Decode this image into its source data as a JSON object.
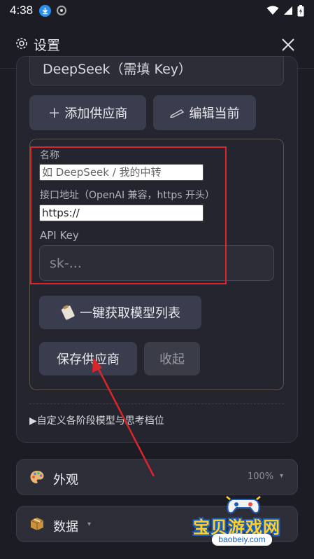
{
  "status_bar": {
    "time": "4:38",
    "icons": [
      "download-icon",
      "record-icon",
      "wifi-icon",
      "signal-icon",
      "battery-icon"
    ]
  },
  "header": {
    "title": "设置",
    "icon": "gear-icon",
    "close_icon": "close-icon"
  },
  "provider_select": {
    "value": "DeepSeek（需填 Key）"
  },
  "buttons": {
    "add_provider": "＋ 添加供应商",
    "edit_current": "编辑当前"
  },
  "form": {
    "name_label": "名称",
    "name_placeholder": "如 DeepSeek / 我的中转",
    "endpoint_label": "接口地址（OpenAI 兼容，https 开头）",
    "endpoint_value": "https://",
    "apikey_label": "API Key",
    "apikey_placeholder": "sk-..."
  },
  "actions": {
    "fetch_models": "一键获取模型列表",
    "save_provider": "保存供应商",
    "collapse": "收起"
  },
  "details_summary": "▶自定义各阶段模型与思考档位",
  "sections": [
    {
      "name": "外观",
      "icon": "palette-icon",
      "value": "100%",
      "chevron": "▾"
    },
    {
      "name": "数据",
      "icon": "box-icon",
      "chevron": "▾"
    }
  ],
  "watermark": {
    "name": "宝贝游戏网",
    "url": "baobeiy.com"
  },
  "colors": {
    "background": "#1c1d24",
    "card": "#24252e",
    "button": "#3a3d4d",
    "highlight": "#d9262c"
  }
}
